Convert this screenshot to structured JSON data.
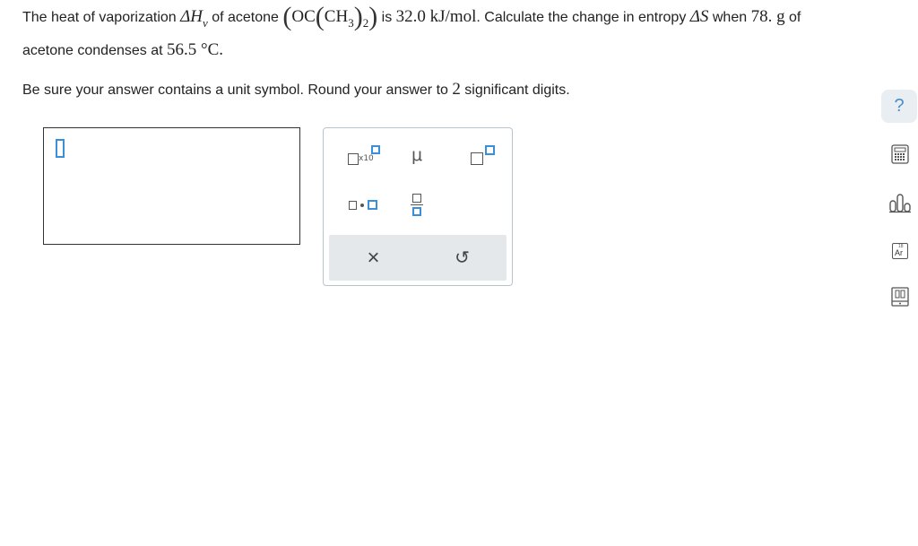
{
  "problem": {
    "line1_prefix": "The heat of vaporization ",
    "delta_h": "ΔH",
    "delta_h_sub": "v",
    "line1_mid": " of acetone ",
    "formula_oc": "OC",
    "formula_ch": "CH",
    "formula_sub3": "3",
    "formula_sub2": "2",
    "line1_is": " is ",
    "enthalpy_value": "32.0 kJ/mol",
    "line1_calc": ". Calculate the change in entropy ",
    "delta_s": "ΔS",
    "line1_when": " when ",
    "mass_value": "78. g",
    "line1_of": " of",
    "line2_prefix": "acetone condenses at ",
    "temperature": "56.5 °C",
    "line2_suffix": "."
  },
  "instruction": {
    "prefix": "Be sure your answer contains a unit symbol. Round your answer to ",
    "digits": "2",
    "suffix": " significant digits."
  },
  "palette": {
    "times_ten_label": "x10",
    "mu_symbol": "μ",
    "clear_symbol": "×",
    "undo_symbol": "↺"
  },
  "tools": {
    "help_symbol": "?",
    "periodic_table_label": "Ar",
    "periodic_table_number": "18"
  },
  "colors": {
    "accent": "#3a8fd8",
    "palette_bottom": "#e4e8eb",
    "help_bg": "#e9eef2"
  }
}
